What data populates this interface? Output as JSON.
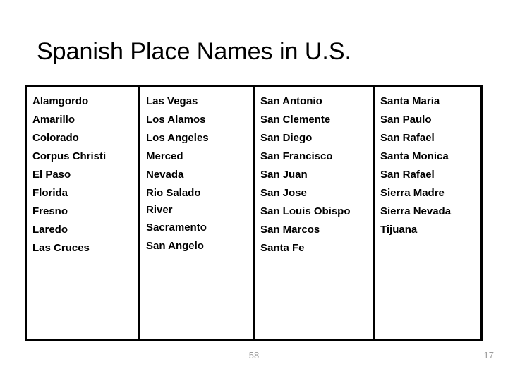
{
  "slide": {
    "title": "Spanish Place Names in U.S.",
    "background_color": "#ffffff",
    "text_color": "#000000",
    "border_color": "#000000"
  },
  "table": {
    "columns": [
      {
        "index": 0,
        "entries": [
          "Alamgordo",
          "Amarillo",
          "Colorado",
          "Corpus Christi",
          "El Paso",
          "Florida",
          "Fresno",
          "Laredo",
          "Las Cruces"
        ]
      },
      {
        "index": 1,
        "entries": [
          "Las Vegas",
          "Los Alamos",
          "Los Angeles",
          "Merced",
          "Nevada",
          "Rio Salado River",
          "Sacramento",
          "San Angelo"
        ],
        "wrapped_entry": {
          "index": 5,
          "line1": "Rio Salado",
          "line2": "River"
        }
      },
      {
        "index": 2,
        "entries": [
          "San Antonio",
          "San Clemente",
          "San Diego",
          "San Francisco",
          "San Juan",
          "San Jose",
          "San Louis Obispo",
          "San Marcos",
          "Santa Fe"
        ]
      },
      {
        "index": 3,
        "entries": [
          "Santa Maria",
          "San Paulo",
          "San Rafael",
          "Santa Monica",
          "San Rafael",
          "Sierra Madre",
          "Sierra Nevada",
          "Tijuana"
        ]
      }
    ]
  },
  "footer": {
    "page_label": "58",
    "slide_number": "17",
    "color": "#9a9a9a"
  }
}
